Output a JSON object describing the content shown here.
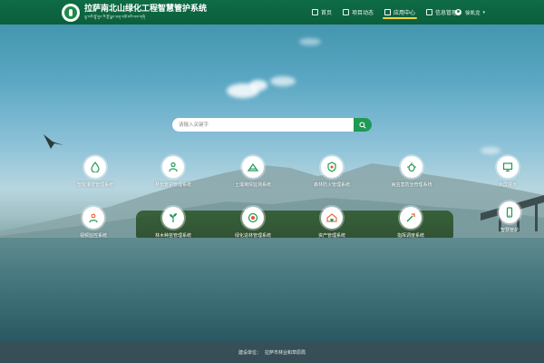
{
  "header": {
    "title": "拉萨南北山绿化工程智慧管护系统",
    "subtitle": "ལྷ་སའི་ལྷོ་བྱང་རི་སྔོ་ལྗང་ཅན་བཟོ་བའི་ལས་གཞི"
  },
  "nav": {
    "items": [
      {
        "label": "首页",
        "icon": "home-icon"
      },
      {
        "label": "项目动态",
        "icon": "news-icon"
      },
      {
        "label": "应用中心",
        "icon": "apps-icon",
        "active": true
      },
      {
        "label": "信息管理",
        "icon": "info-icon"
      }
    ]
  },
  "user": {
    "name": "徐凯龙"
  },
  "search": {
    "placeholder": "请输入关键字",
    "value": ""
  },
  "systems": [
    {
      "label": "智能灌溉管理系统",
      "icon": "irrigation-icon"
    },
    {
      "label": "林长管护管理系统",
      "icon": "forest-ranger-icon"
    },
    {
      "label": "土壤墒情监测系统",
      "icon": "soil-monitor-icon"
    },
    {
      "label": "森林防火管理系统",
      "icon": "fire-prevention-icon"
    },
    {
      "label": "病虫害防治管理系统",
      "icon": "pest-control-icon"
    },
    {
      "label": "大屏展示",
      "icon": "big-screen-icon"
    },
    {
      "label": "视频监控系统",
      "icon": "video-monitor-icon"
    },
    {
      "label": "林木种苗管理系统",
      "icon": "seedling-icon"
    },
    {
      "label": "绿化造林管理系统",
      "icon": "afforestation-icon"
    },
    {
      "label": "资产管理系统",
      "icon": "asset-icon"
    },
    {
      "label": "指挥调度系统",
      "icon": "dispatch-icon"
    },
    {
      "label": "智慧管护",
      "icon": "mobile-icon"
    }
  ],
  "footer": {
    "label": "建设单位：",
    "org": "拉萨市林业和草原局"
  },
  "colors": {
    "header_bg": "#0e6c45",
    "accent_green": "#1e9a54",
    "active_underline": "#f5d23b"
  }
}
